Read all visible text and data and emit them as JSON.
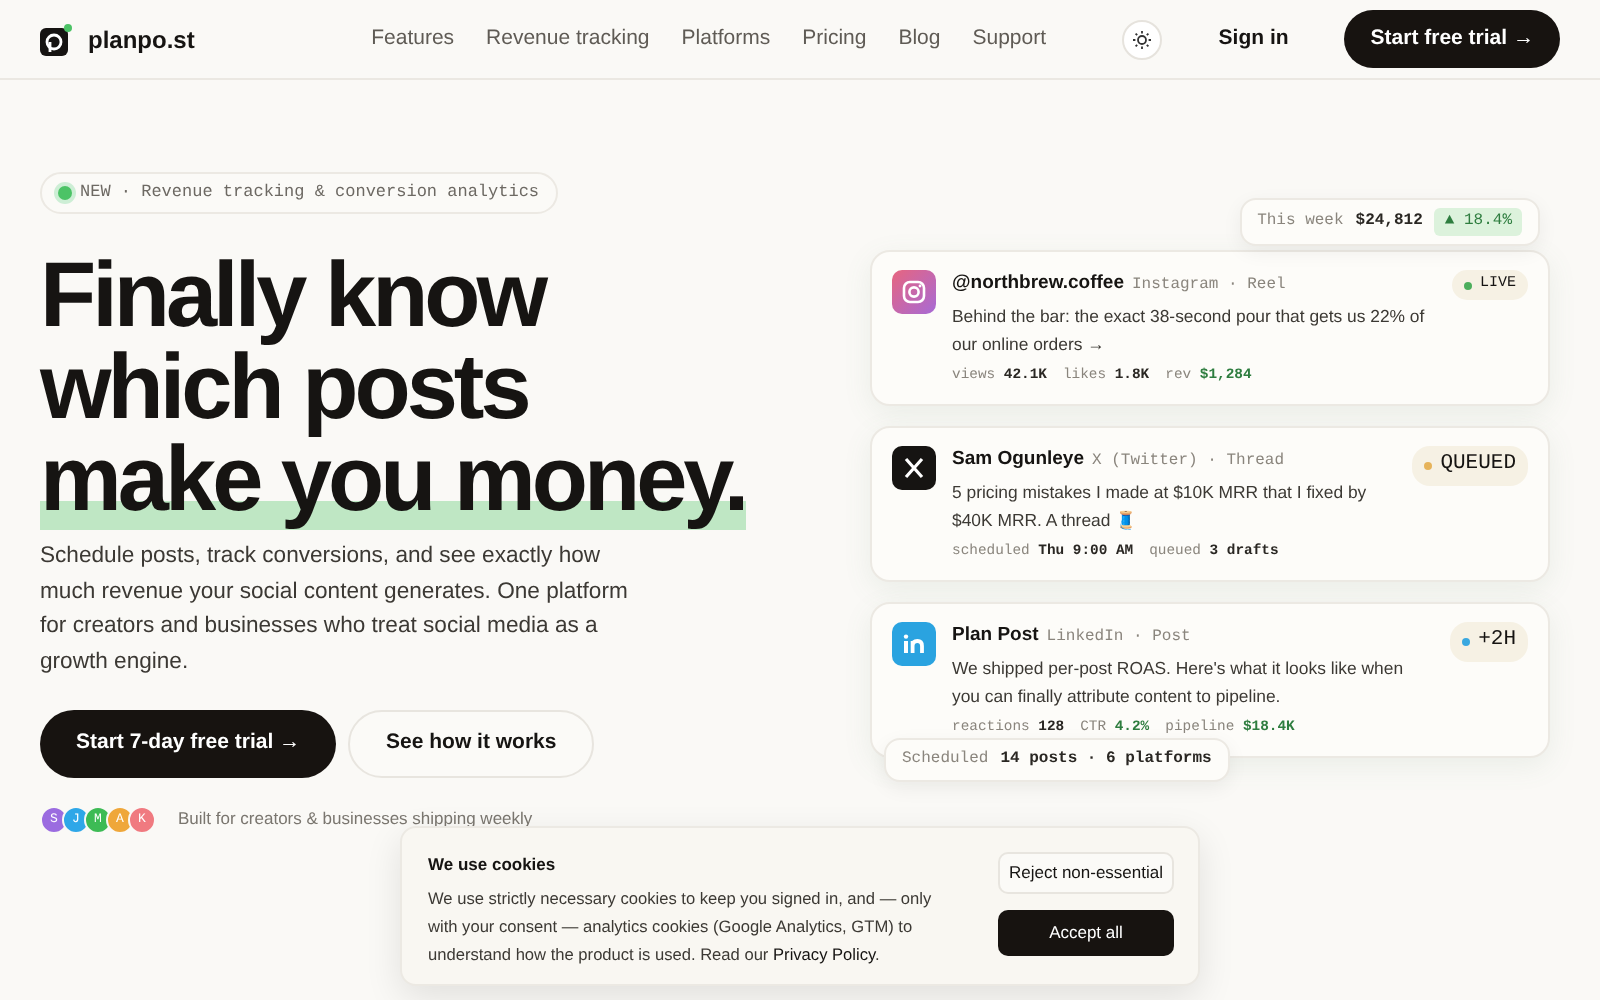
{
  "nav": {
    "brand": "planpo.st",
    "links": [
      "Features",
      "Revenue tracking",
      "Platforms",
      "Pricing",
      "Blog",
      "Support"
    ],
    "sign_in": "Sign in",
    "cta": "Start free trial →"
  },
  "hero": {
    "pill": {
      "tag": "NEW",
      "text": "· Revenue tracking & conversion analytics"
    },
    "headline": [
      "Finally know",
      "which posts",
      "make you money."
    ],
    "subtitle": "Schedule posts, track conversions, and see exactly how much revenue your social content generates. One platform for creators and businesses who treat social media as a growth engine.",
    "primary": "Start 7-day free trial →",
    "secondary": "See how it works",
    "avatars": [
      {
        "letter": "S",
        "color": "#9b6ce0"
      },
      {
        "letter": "J",
        "color": "#2ea7e8"
      },
      {
        "letter": "M",
        "color": "#3dbb55"
      },
      {
        "letter": "A",
        "color": "#efa73a"
      },
      {
        "letter": "K",
        "color": "#f07a80"
      }
    ],
    "social_proof": "Built for creators & businesses shipping weekly"
  },
  "week_chip": {
    "label": "This week",
    "value": "$24,812",
    "change": "▲ 18.4%"
  },
  "posts": [
    {
      "kind": "instagram",
      "author": "@northbrew.coffee",
      "meta": "Instagram · Reel",
      "status": {
        "text": "LIVE",
        "color": "#4cae5c"
      },
      "body": "Behind the bar: the exact 38-second pour that gets us 22% of our online orders →",
      "stats": [
        {
          "label": "views",
          "value": "42.1K",
          "money": false
        },
        {
          "label": "likes",
          "value": "1.8K",
          "money": false
        },
        {
          "label": "rev",
          "value": "$1,284",
          "money": true
        }
      ]
    },
    {
      "kind": "x",
      "author": "Sam Ogunleye",
      "meta": "X (Twitter) · Thread",
      "status": {
        "text": "QUEUED",
        "color": "#e6b35a"
      },
      "body": "5 pricing mistakes I made at $10K MRR that I fixed by $40K MRR. A thread 🧵",
      "stats": [
        {
          "label": "scheduled",
          "value": "Thu 9:00 AM",
          "money": false
        },
        {
          "label": "queued",
          "value": "3 drafts",
          "money": false
        }
      ]
    },
    {
      "kind": "linkedin",
      "author": "Plan Post",
      "meta": "LinkedIn · Post",
      "status": {
        "text": "+2H",
        "color": "#3aa8e0"
      },
      "body": "We shipped per-post ROAS. Here's what it looks like when you can finally attribute content to pipeline.",
      "stats": [
        {
          "label": "reactions",
          "value": "128",
          "money": false
        },
        {
          "label": "CTR",
          "value": "4.2%",
          "money": true
        },
        {
          "label": "pipeline",
          "value": "$18.4K",
          "money": true
        }
      ]
    }
  ],
  "scheduled_chip": {
    "label": "Scheduled",
    "value": "14 posts · 6 platforms"
  },
  "cookies": {
    "title": "We use cookies",
    "body": "We use strictly necessary cookies to keep you signed in, and — only with your consent — analytics cookies (Google Analytics, GTM) to understand how the product is used. Read our ",
    "link": "Privacy Policy",
    "end": ".",
    "reject": "Reject non-essential",
    "accept": "Accept all"
  }
}
